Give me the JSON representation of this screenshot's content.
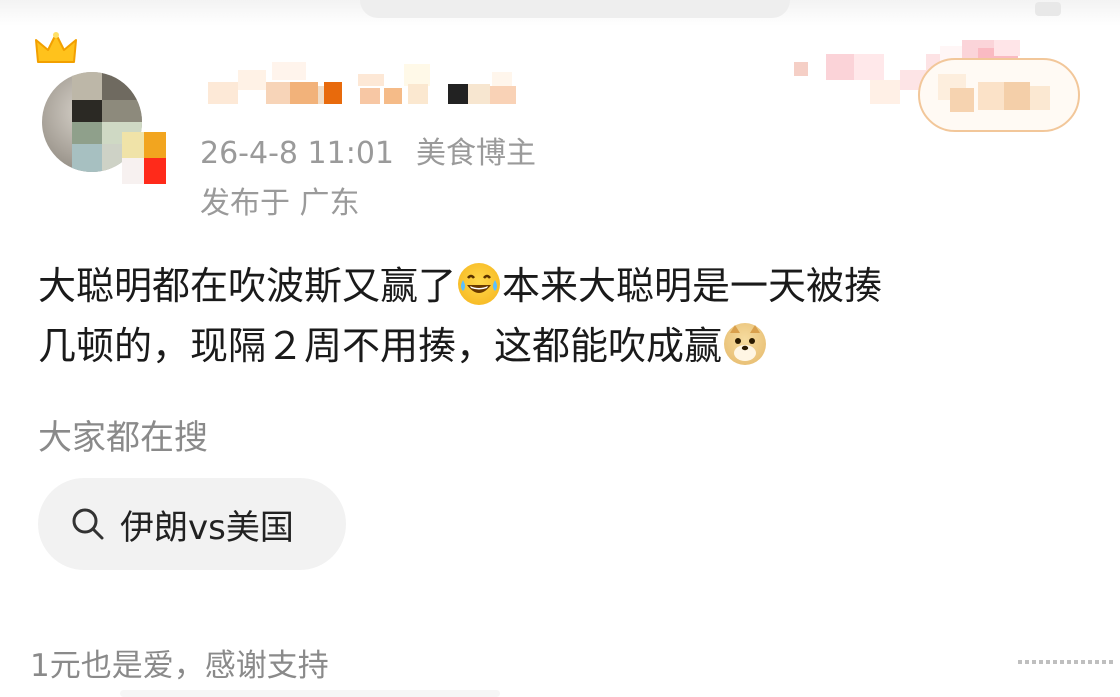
{
  "post": {
    "timestamp": "26-4-8 11:01",
    "author_tag": "美食博主",
    "location": "发布于 广东",
    "content_line1_a": "大聪明都在吹波斯又赢了",
    "content_line1_b": "本来大聪明是一天被揍",
    "content_line2_a": "几顿的，现隔２周不用揍，这都能吹成赢",
    "emoji_1": "laughing-crying",
    "emoji_2": "doge"
  },
  "search": {
    "heading": "大家都在搜",
    "chip_label": "伊朗vs美国",
    "icon": "search-icon"
  },
  "footer": {
    "support_text": "1元也是爱，感谢支持"
  },
  "colors": {
    "meta_gray": "#9a9a9a",
    "follow_border": "#f2c79a",
    "chip_bg": "#f2f2f2"
  }
}
